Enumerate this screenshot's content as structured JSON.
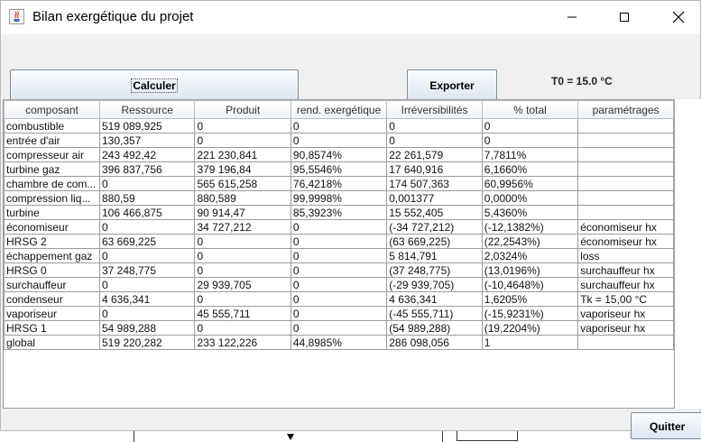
{
  "window": {
    "title": "Bilan exergétique du projet"
  },
  "toolbar": {
    "calculate_label": "Calculer",
    "export_label": "Exporter",
    "t0_label": "T0 = 15.0 °C"
  },
  "table": {
    "columns": [
      "composant",
      "Ressource",
      "Produit",
      "rend. exergétique",
      "Irréversibilités",
      "% total",
      "paramétrages"
    ],
    "rows": [
      [
        "combustible",
        "519 089,925",
        "0",
        "0",
        "0",
        "0",
        ""
      ],
      [
        "entrée d'air",
        "130,357",
        "0",
        "0",
        "0",
        "0",
        ""
      ],
      [
        "compresseur air",
        "243 492,42",
        "221 230,841",
        "90,8574%",
        "22 261,579",
        "7,7811%",
        ""
      ],
      [
        "turbine gaz",
        "396 837,756",
        "379 196,84",
        "95,5546%",
        "17 640,916",
        "6,1660%",
        ""
      ],
      [
        "chambre de com...",
        "0",
        "565 615,258",
        "76,4218%",
        "174 507,363",
        "60,9956%",
        ""
      ],
      [
        "compression liq...",
        "880,59",
        "880,589",
        "99,9998%",
        "0,001377",
        "0,0000%",
        ""
      ],
      [
        "turbine",
        "106 466,875",
        "90 914,47",
        "85,3923%",
        "15 552,405",
        "5,4360%",
        ""
      ],
      [
        "économiseur",
        "0",
        "34 727,212",
        "0",
        "(-34 727,212)",
        "(-12,1382%)",
        "économiseur hx"
      ],
      [
        "HRSG 2",
        "63 669,225",
        "0",
        "0",
        "(63 669,225)",
        "(22,2543%)",
        "économiseur hx"
      ],
      [
        "échappement gaz",
        "0",
        "0",
        "0",
        "5 814,791",
        "2,0324%",
        "loss"
      ],
      [
        "HRSG 0",
        "37 248,775",
        "0",
        "0",
        "(37 248,775)",
        "(13,0196%)",
        "surchauffeur hx"
      ],
      [
        "surchauffeur",
        "0",
        "29 939,705",
        "0",
        "(-29 939,705)",
        "(-10,4648%)",
        "surchauffeur hx"
      ],
      [
        "condenseur",
        "4 636,341",
        "0",
        "0",
        "4 636,341",
        "1,6205%",
        "Tk = 15,00 °C"
      ],
      [
        "vaporiseur",
        "0",
        "45 555,711",
        "0",
        "(-45 555,711)",
        "(-15,9231%)",
        "vaporiseur hx"
      ],
      [
        "HRSG 1",
        "54 989,288",
        "0",
        "0",
        "(54 989,288)",
        "(19,2204%)",
        "vaporiseur hx"
      ],
      [
        "global",
        "519 220,282",
        "233 122,226",
        "44,8985%",
        "286 098,056",
        "1",
        ""
      ]
    ]
  },
  "footer": {
    "quit_label": "Quitter"
  }
}
